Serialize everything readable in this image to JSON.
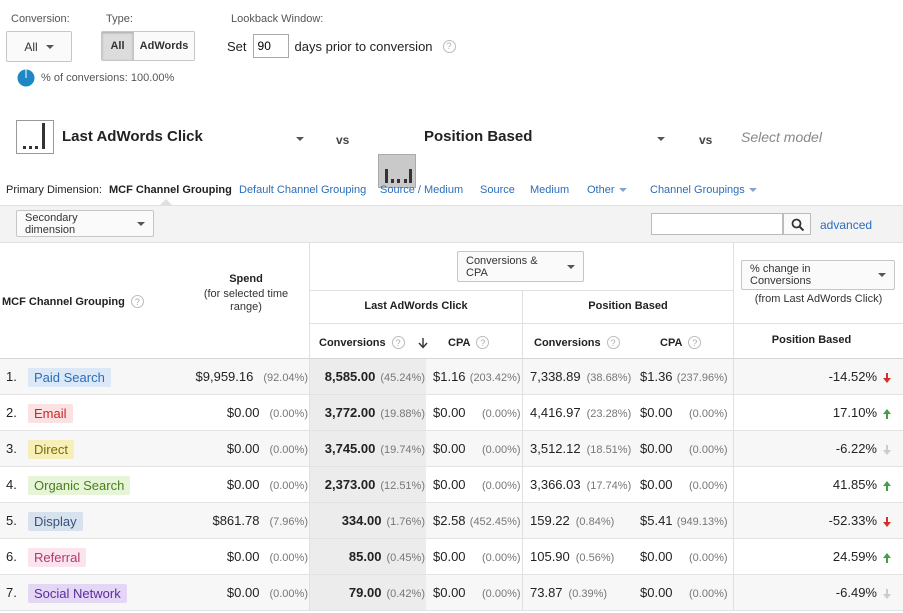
{
  "controls": {
    "conversion_label": "Conversion:",
    "conversion_value": "All",
    "type_label": "Type:",
    "type_all": "All",
    "type_adwords": "AdWords",
    "lookback_label": "Lookback Window:",
    "lookback_set": "Set",
    "lookback_days": "90",
    "lookback_suffix": "days prior to conversion",
    "pct_conversions": "% of conversions: 100.00%"
  },
  "models": {
    "model1": "Last AdWords Click",
    "vs1": "vs",
    "model2": "Position Based",
    "vs2": "vs",
    "model3_placeholder": "Select model"
  },
  "dimensions": {
    "label": "Primary Dimension:",
    "active": "MCF Channel Grouping",
    "links": [
      "Default Channel Grouping",
      "Source / Medium",
      "Source",
      "Medium",
      "Other"
    ],
    "channel_groupings": "Channel Groupings"
  },
  "toolbar": {
    "secondary_dimension": "Secondary dimension",
    "advanced": "advanced"
  },
  "table": {
    "col_channel": "MCF Channel Grouping",
    "col_spend": "Spend",
    "col_spend_sub": "(for selected time range)",
    "metric_select": "Conversions & CPA",
    "group1": "Last AdWords Click",
    "group2": "Position Based",
    "sub_conversions": "Conversions",
    "sub_cpa": "CPA",
    "change_select": "% change in Conversions",
    "change_sub": "(from Last AdWords Click)",
    "change_model": "Position Based",
    "rows": [
      {
        "idx": "1.",
        "channel": "Paid Search",
        "bg": "#dbe8f7",
        "fg": "#2a6ebb",
        "spend": "$9,959.16",
        "spend_pct": "(92.04%)",
        "conv1": "8,585.00",
        "conv1_pct": "(45.24%)",
        "cpa1": "$1.16",
        "cpa1_pct": "(203.42%)",
        "conv2": "7,338.89",
        "conv2_pct": "(38.68%)",
        "cpa2": "$1.36",
        "cpa2_pct": "(237.96%)",
        "change": "-14.52%",
        "dir": "down",
        "arrow_color": "#d32f2f"
      },
      {
        "idx": "2.",
        "channel": "Email",
        "bg": "#fbe1e1",
        "fg": "#c62828",
        "spend": "$0.00",
        "spend_pct": "(0.00%)",
        "conv1": "3,772.00",
        "conv1_pct": "(19.88%)",
        "cpa1": "$0.00",
        "cpa1_pct": "(0.00%)",
        "conv2": "4,416.97",
        "conv2_pct": "(23.28%)",
        "cpa2": "$0.00",
        "cpa2_pct": "(0.00%)",
        "change": "17.10%",
        "dir": "up",
        "arrow_color": "#43a047"
      },
      {
        "idx": "3.",
        "channel": "Direct",
        "bg": "#f6f0b8",
        "fg": "#7d6b00",
        "spend": "$0.00",
        "spend_pct": "(0.00%)",
        "conv1": "3,745.00",
        "conv1_pct": "(19.74%)",
        "cpa1": "$0.00",
        "cpa1_pct": "(0.00%)",
        "conv2": "3,512.12",
        "conv2_pct": "(18.51%)",
        "cpa2": "$0.00",
        "cpa2_pct": "(0.00%)",
        "change": "-6.22%",
        "dir": "down",
        "arrow_color": "#cccccc"
      },
      {
        "idx": "4.",
        "channel": "Organic Search",
        "bg": "#e6f4d7",
        "fg": "#4a7d1e",
        "spend": "$0.00",
        "spend_pct": "(0.00%)",
        "conv1": "2,373.00",
        "conv1_pct": "(12.51%)",
        "cpa1": "$0.00",
        "cpa1_pct": "(0.00%)",
        "conv2": "3,366.03",
        "conv2_pct": "(17.74%)",
        "cpa2": "$0.00",
        "cpa2_pct": "(0.00%)",
        "change": "41.85%",
        "dir": "up",
        "arrow_color": "#43a047"
      },
      {
        "idx": "5.",
        "channel": "Display",
        "bg": "#d8e2ef",
        "fg": "#37527a",
        "spend": "$861.78",
        "spend_pct": "(7.96%)",
        "conv1": "334.00",
        "conv1_pct": "(1.76%)",
        "cpa1": "$2.58",
        "cpa1_pct": "(452.45%)",
        "conv2": "159.22",
        "conv2_pct": "(0.84%)",
        "cpa2": "$5.41",
        "cpa2_pct": "(949.13%)",
        "change": "-52.33%",
        "dir": "down",
        "arrow_color": "#d32f2f"
      },
      {
        "idx": "6.",
        "channel": "Referral",
        "bg": "#fbe4ee",
        "fg": "#b03a6a",
        "spend": "$0.00",
        "spend_pct": "(0.00%)",
        "conv1": "85.00",
        "conv1_pct": "(0.45%)",
        "cpa1": "$0.00",
        "cpa1_pct": "(0.00%)",
        "conv2": "105.90",
        "conv2_pct": "(0.56%)",
        "cpa2": "$0.00",
        "cpa2_pct": "(0.00%)",
        "change": "24.59%",
        "dir": "up",
        "arrow_color": "#43a047"
      },
      {
        "idx": "7.",
        "channel": "Social Network",
        "bg": "#e4d6f5",
        "fg": "#5b2d99",
        "spend": "$0.00",
        "spend_pct": "(0.00%)",
        "conv1": "79.00",
        "conv1_pct": "(0.42%)",
        "cpa1": "$0.00",
        "cpa1_pct": "(0.00%)",
        "conv2": "73.87",
        "conv2_pct": "(0.39%)",
        "cpa2": "$0.00",
        "cpa2_pct": "(0.00%)",
        "change": "-6.49%",
        "dir": "down",
        "arrow_color": "#cccccc"
      }
    ]
  }
}
